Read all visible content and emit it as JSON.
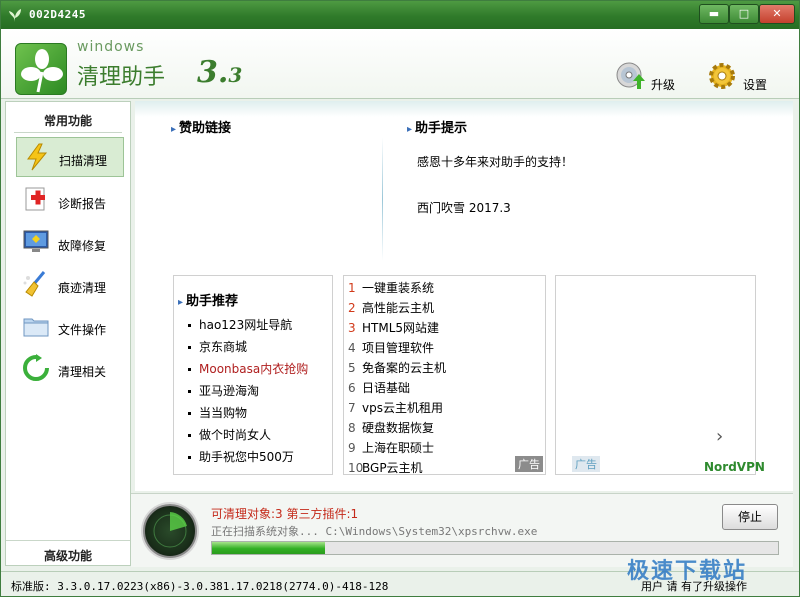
{
  "window": {
    "title": "002D4245",
    "min_glyph": "▬",
    "max_glyph": "□",
    "close_glyph": "✕"
  },
  "header": {
    "brand_small": "windows",
    "brand_main": "清理助手",
    "brand_version": "3.",
    "brand_version_minor": "3",
    "upgrade_label": "升级",
    "settings_label": "设置"
  },
  "sidebar": {
    "common_heading": "常用功能",
    "advanced_heading": "高级功能",
    "items": [
      {
        "label": "扫描清理"
      },
      {
        "label": "诊断报告"
      },
      {
        "label": "故障修复"
      },
      {
        "label": "痕迹清理"
      },
      {
        "label": "文件操作"
      },
      {
        "label": "清理相关"
      }
    ]
  },
  "main": {
    "sponsor_title": "赞助链接",
    "tips_title": "助手提示",
    "tips_line1": "感恩十多年来对助手的支持！",
    "tips_line2": "西门吹雪  2017.3",
    "recommend_title": "助手推荐",
    "recommend": [
      {
        "label": "hao123网址导航"
      },
      {
        "label": "京东商城"
      },
      {
        "label": "Moonbasa内衣抢购"
      },
      {
        "label": "亚马逊海淘"
      },
      {
        "label": "当当购物"
      },
      {
        "label": "做个时尚女人"
      },
      {
        "label": "助手祝您中500万"
      }
    ],
    "ad_list": [
      {
        "num": "1",
        "label": "一键重装系统"
      },
      {
        "num": "2",
        "label": "高性能云主机"
      },
      {
        "num": "3",
        "label": "HTML5网站建"
      },
      {
        "num": "4",
        "label": "项目管理软件"
      },
      {
        "num": "5",
        "label": "免备案的云主机"
      },
      {
        "num": "6",
        "label": "日语基础"
      },
      {
        "num": "7",
        "label": "vps云主机租用"
      },
      {
        "num": "8",
        "label": "硬盘数据恢复"
      },
      {
        "num": "9",
        "label": "上海在职硕士"
      },
      {
        "num": "10",
        "label": "BGP云主机"
      }
    ],
    "ad_tag": "广告",
    "ad_next_glyph": "›",
    "ad_brand": "NordVPN"
  },
  "scan": {
    "status": "可清理对象:3  第三方插件:1",
    "path": "正在扫描系统对象...  C:\\Windows\\System32\\xpsrchvw.exe",
    "progress": 0.2,
    "stop_label": "停止"
  },
  "statusbar": {
    "version": "标准版: 3.3.0.17.0223(x86)-3.0.381.17.0218(2774.0)-418-128",
    "right_text": "用户 请 有了升级操作"
  },
  "watermark": {
    "text": "极速下载站"
  },
  "colors": {
    "accent": "#3c7d2e",
    "titlebar": "#2f7a2a",
    "status_red": "#c42a1a",
    "progress": "#32b024"
  }
}
